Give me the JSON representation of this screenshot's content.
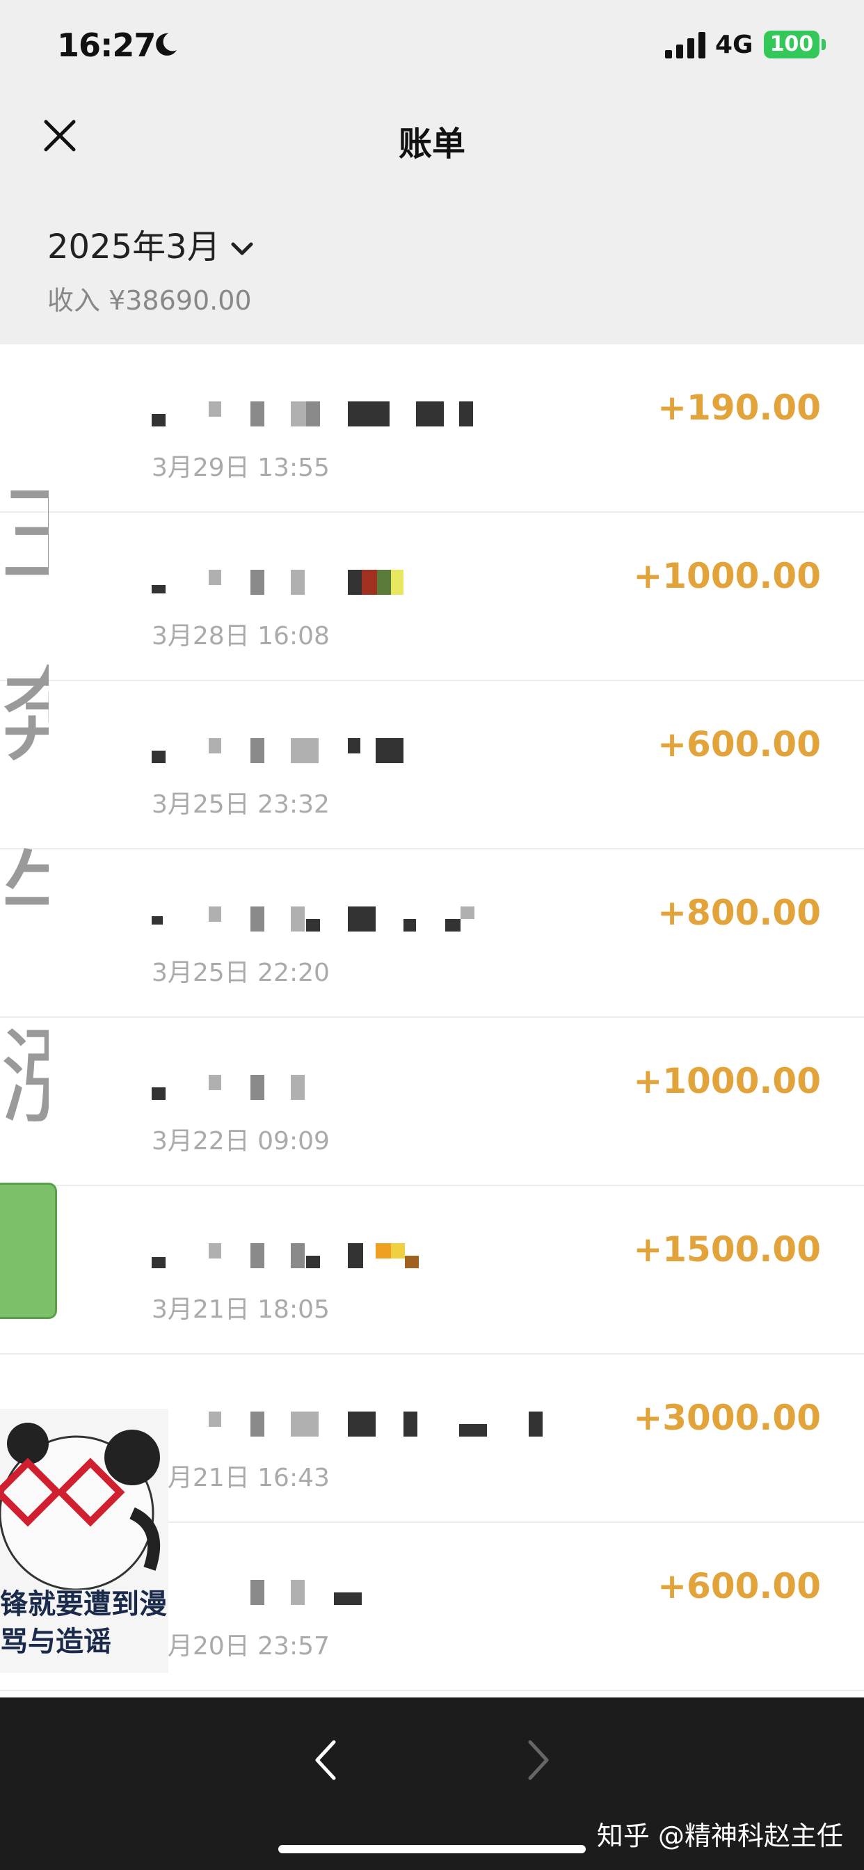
{
  "status": {
    "time": "16:27",
    "network": "4G",
    "battery": "100"
  },
  "nav": {
    "title": "账单"
  },
  "summary": {
    "month": "2025年3月",
    "income": "收入 ¥38690.00"
  },
  "transactions": [
    {
      "date": "3月29日 13:55",
      "amount": "+190.00"
    },
    {
      "date": "3月28日 16:08",
      "amount": "+1000.00"
    },
    {
      "date": "3月25日 23:32",
      "amount": "+600.00"
    },
    {
      "date": "3月25日 22:20",
      "amount": "+800.00"
    },
    {
      "date": "3月22日 09:09",
      "amount": "+1000.00"
    },
    {
      "date": "3月21日 18:05",
      "amount": "+1500.00"
    },
    {
      "date": "3月21日 16:43",
      "amount": "+3000.00"
    },
    {
      "date": "3月20日 23:57",
      "amount": "+600.00"
    }
  ],
  "overlay": {
    "vertical_text": "王奔牛涨斗工",
    "sticker_text": "锋就要遭到漫骂与造谣"
  },
  "watermark": "知乎 @精神科赵主任",
  "colors": {
    "amount": "#e2a43a",
    "background": "#efefef",
    "bottom_bar": "#1c1c1c"
  }
}
